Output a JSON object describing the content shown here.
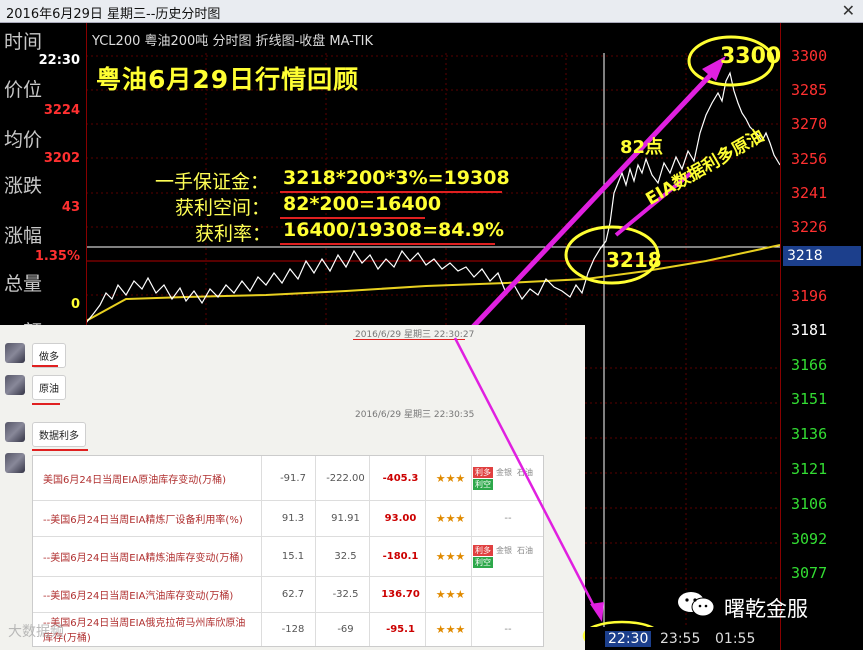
{
  "window": {
    "title": "2016年6月29日 星期三--历史分时图",
    "close_glyph": "✕"
  },
  "left_panel": {
    "items": [
      {
        "label": "时间",
        "value": "22:30",
        "color": "#ffffff"
      },
      {
        "label": "价位",
        "value": "3224",
        "color": "#ff3030"
      },
      {
        "label": "均价",
        "value": "3202",
        "color": "#ff3030"
      },
      {
        "label": "涨跌",
        "value": "43",
        "color": "#ff3030"
      },
      {
        "label": "涨幅",
        "value": "1.35%",
        "color": "#ff3030"
      },
      {
        "label": "总量",
        "value": "0",
        "color": "#ffff33"
      }
    ],
    "partial_label": "…额"
  },
  "chart_header": {
    "text": "YCL200  粤油200吨  分时图  折线图-收盘  MA-TIK"
  },
  "overlay": {
    "title": "粤油6月29日行情回顾",
    "calc": [
      {
        "label": "一手保证金：",
        "value": "3218*200*3%=19308"
      },
      {
        "label": "获利空间：",
        "value": "82*200=16400"
      },
      {
        "label": "获利率：",
        "value": "16400/19308=84.9%"
      }
    ],
    "circle_high": "3300",
    "circle_low": "3218",
    "points_label": "82点",
    "eia_label": "EIA数据利多原油"
  },
  "right_axis": {
    "ticks": [
      {
        "v": "3300",
        "color": "#ff3030"
      },
      {
        "v": "3285",
        "color": "#ff3030"
      },
      {
        "v": "3270",
        "color": "#ff3030"
      },
      {
        "v": "3256",
        "color": "#ff3030"
      },
      {
        "v": "3241",
        "color": "#ff3030"
      },
      {
        "v": "3226",
        "color": "#ff3030"
      },
      {
        "v": "3196",
        "color": "#ff3030"
      },
      {
        "v": "3181",
        "color": "#ffffff"
      },
      {
        "v": "3166",
        "color": "#33dd33"
      },
      {
        "v": "3151",
        "color": "#33dd33"
      },
      {
        "v": "3136",
        "color": "#33dd33"
      },
      {
        "v": "3121",
        "color": "#33dd33"
      },
      {
        "v": "3106",
        "color": "#33dd33"
      },
      {
        "v": "3092",
        "color": "#33dd33"
      },
      {
        "v": "3077",
        "color": "#33dd33"
      }
    ],
    "current_price": "3218"
  },
  "bottom_axis": {
    "times": [
      "22:30",
      "23:55",
      "01:55"
    ]
  },
  "chat": {
    "timestamp1": "2016/6/29 星期三 22:30:27",
    "timestamp2": "2016/6/29 星期三 22:30:35",
    "messages": [
      "做多",
      "原油",
      "数据利多"
    ],
    "table_rows": [
      {
        "name": "美国6月24日当周EIA原油库存变动(万桶)",
        "v1": "-91.7",
        "v2": "-222.00",
        "v3": "-405.3",
        "stars": "★★★",
        "tags": [
          "利多",
          "金银",
          "石油",
          "利空"
        ]
      },
      {
        "name": "--美国6月24日当周EIA精炼厂设备利用率(%)",
        "v1": "91.3",
        "v2": "91.91",
        "v3": "93.00",
        "stars": "★★★",
        "tags": [
          "--"
        ]
      },
      {
        "name": "--美国6月24日当周EIA精炼油库存变动(万桶)",
        "v1": "15.1",
        "v2": "32.5",
        "v3": "-180.1",
        "stars": "★★★",
        "tags": [
          "利多",
          "金银",
          "石油",
          "利空"
        ]
      },
      {
        "name": "--美国6月24日当周EIA汽油库存变动(万桶)",
        "v1": "62.7",
        "v2": "-32.5",
        "v3": "136.70",
        "stars": "★★★",
        "tags": []
      },
      {
        "name": "--美国6月24日当周EIA俄克拉荷马州库欣原油库存(万桶)",
        "v1": "-128",
        "v2": "-69",
        "v3": "-95.1",
        "stars": "★★★",
        "tags": [
          "--"
        ]
      }
    ]
  },
  "watermark": {
    "text": "曙乾金服",
    "bottom_left": "大数据频"
  }
}
